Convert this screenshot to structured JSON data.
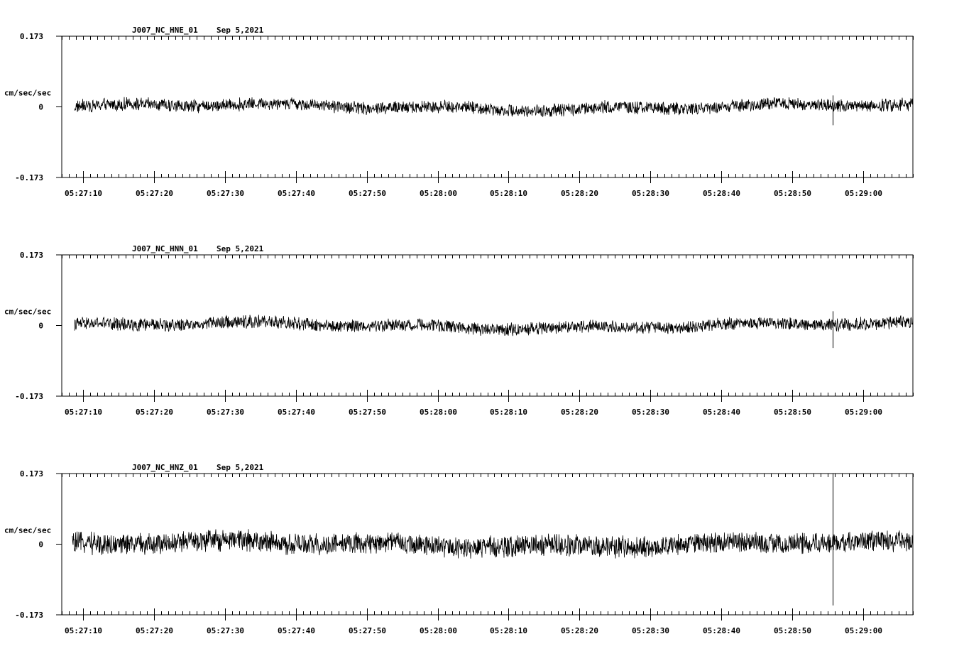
{
  "page": {
    "background": "#ffffff",
    "ink": "#000000"
  },
  "chart_data": [
    {
      "type": "line",
      "station": "J007_NC_HNE_01",
      "date": "Sep 5,2021",
      "ylabel": "cm/sec/sec",
      "yticks": [
        "0.173",
        "0",
        "-0.173"
      ],
      "ylim": [
        -0.173,
        0.173
      ],
      "xlim": [
        "05:27:07",
        "05:29:07"
      ],
      "data_start": "05:27:08.8",
      "xticks": [
        "05:27:10",
        "05:27:20",
        "05:27:30",
        "05:27:40",
        "05:27:50",
        "05:28:00",
        "05:28:10",
        "05:28:20",
        "05:28:30",
        "05:28:40",
        "05:28:50",
        "05:29:00"
      ],
      "noise_amplitude": 0.018,
      "spikes": [
        {
          "time": "05:28:55.7",
          "min": -0.045,
          "max": 0.028
        }
      ]
    },
    {
      "type": "line",
      "station": "J007_NC_HNN_01",
      "date": "Sep 5,2021",
      "ylabel": "cm/sec/sec",
      "yticks": [
        "0.173",
        "0",
        "-0.173"
      ],
      "ylim": [
        -0.173,
        0.173
      ],
      "xlim": [
        "05:27:07",
        "05:29:07"
      ],
      "data_start": "05:27:08.8",
      "xticks": [
        "05:27:10",
        "05:27:20",
        "05:27:30",
        "05:27:40",
        "05:27:50",
        "05:28:00",
        "05:28:10",
        "05:28:20",
        "05:28:30",
        "05:28:40",
        "05:28:50",
        "05:29:00"
      ],
      "noise_amplitude": 0.018,
      "spikes": [
        {
          "time": "05:28:55.7",
          "min": -0.055,
          "max": 0.035
        }
      ]
    },
    {
      "type": "line",
      "station": "J007_NC_HNZ_01",
      "date": "Sep 5,2021",
      "ylabel": "cm/sec/sec",
      "yticks": [
        "0.173",
        "0",
        "-0.173"
      ],
      "ylim": [
        -0.173,
        0.173
      ],
      "xlim": [
        "05:27:07",
        "05:29:07"
      ],
      "data_start": "05:27:08.5",
      "xticks": [
        "05:27:10",
        "05:27:20",
        "05:27:30",
        "05:27:40",
        "05:27:50",
        "05:28:00",
        "05:28:10",
        "05:28:20",
        "05:28:30",
        "05:28:40",
        "05:28:50",
        "05:29:00"
      ],
      "noise_amplitude": 0.03,
      "spikes": [
        {
          "time": "05:28:55.7",
          "min": -0.15,
          "max": 0.173
        }
      ]
    }
  ]
}
